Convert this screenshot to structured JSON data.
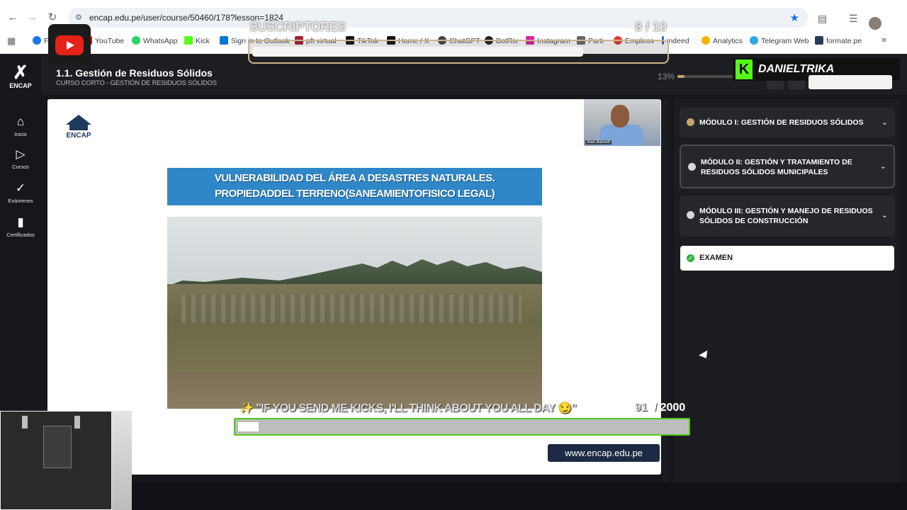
{
  "browser": {
    "url": "encap.edu.pe/user/course/50460/178?lesson=1824",
    "bookmarks": [
      {
        "label": "Fac",
        "color": "#1877f2"
      },
      {
        "label": "YouTube",
        "color": "#ff0000"
      },
      {
        "label": "WhatsApp",
        "color": "#25d366"
      },
      {
        "label": "Kick",
        "color": "#53fc18"
      },
      {
        "label": "Sign in to Outlook",
        "color": "#0078d4"
      },
      {
        "label": "pft virtual",
        "color": "#a31f34"
      },
      {
        "label": "TikTok",
        "color": "#111111"
      },
      {
        "label": "Home / X",
        "color": "#111111"
      },
      {
        "label": "ChatGPT",
        "color": "#444444"
      },
      {
        "label": "BotRix",
        "color": "#222222"
      },
      {
        "label": "Instagram",
        "color": "#d6249f"
      },
      {
        "label": "Parti",
        "color": "#666666"
      },
      {
        "label": "Empleos",
        "color": "#e03a2f"
      },
      {
        "label": "indeed",
        "color": "#2164f3"
      },
      {
        "label": "Analytics",
        "color": "#f4b400"
      },
      {
        "label": "Telegram Web",
        "color": "#29a9eb"
      },
      {
        "label": "formate.pe",
        "color": "#2a3b5a"
      }
    ]
  },
  "overlay": {
    "subs_label": "SUSCRIPTORES",
    "subs_current": "8",
    "subs_goal": "/ 10",
    "subs_progress": 0.8,
    "kick_user": "DANIELTRIKA",
    "kick_goal_text": "\"IF YOU SEND ME KICKS, I'LL THINK ABOUT YOU ALL DAY 😏\"",
    "kick_sparkle": "✨",
    "kick_current": "91",
    "kick_total": "/ 2000",
    "kick_progress": 0.0455
  },
  "header": {
    "lesson_title": "1.1. Gestión de Residuos Sólidos",
    "course_subtitle": "CURSO CORTO - GESTIÓN DE RESIDUOS SÓLIDOS",
    "progress_label": "13%",
    "progress_value": 0.13
  },
  "sidebar": {
    "brand": "ENCAP",
    "items": [
      {
        "label": "Inicio",
        "icon": "home-icon"
      },
      {
        "label": "Cursos",
        "icon": "play-circle-icon"
      },
      {
        "label": "Exámenes",
        "icon": "check-icon"
      },
      {
        "label": "Certificados",
        "icon": "bookmark-icon"
      }
    ]
  },
  "video": {
    "logo_text": "ENCAP",
    "presenter_caption": "Alan Barnett",
    "slide_title_line1": "VULNERABILIDAD DEL ÁREA A DESASTRES NATURALES.",
    "slide_title_line2": "PROPIEDADDEL TERRENO(SANEAMIENTOFISICO LEGAL)",
    "url_badge": "www.encap.edu.pe"
  },
  "modules": [
    {
      "title": "MÓDULO I: GESTIÓN DE RESIDUOS SÓLIDOS",
      "status": "done"
    },
    {
      "title": "MÓDULO II: GESTIÓN Y TRATAMIENTO DE RESIDUOS SÓLIDOS MUNICIPALES",
      "status": "active"
    },
    {
      "title": "MÓDULO III: GESTIÓN Y MANEJO DE RESIDUOS SÓLIDOS DE CONSTRUCCIÓN",
      "status": "pending"
    }
  ],
  "exam": {
    "label": "EXAMEN",
    "color": "#2fb344"
  },
  "colors": {
    "accent": "#c6a36e",
    "kick_green": "#53fc18",
    "slide_blue": "#2f87c8"
  }
}
